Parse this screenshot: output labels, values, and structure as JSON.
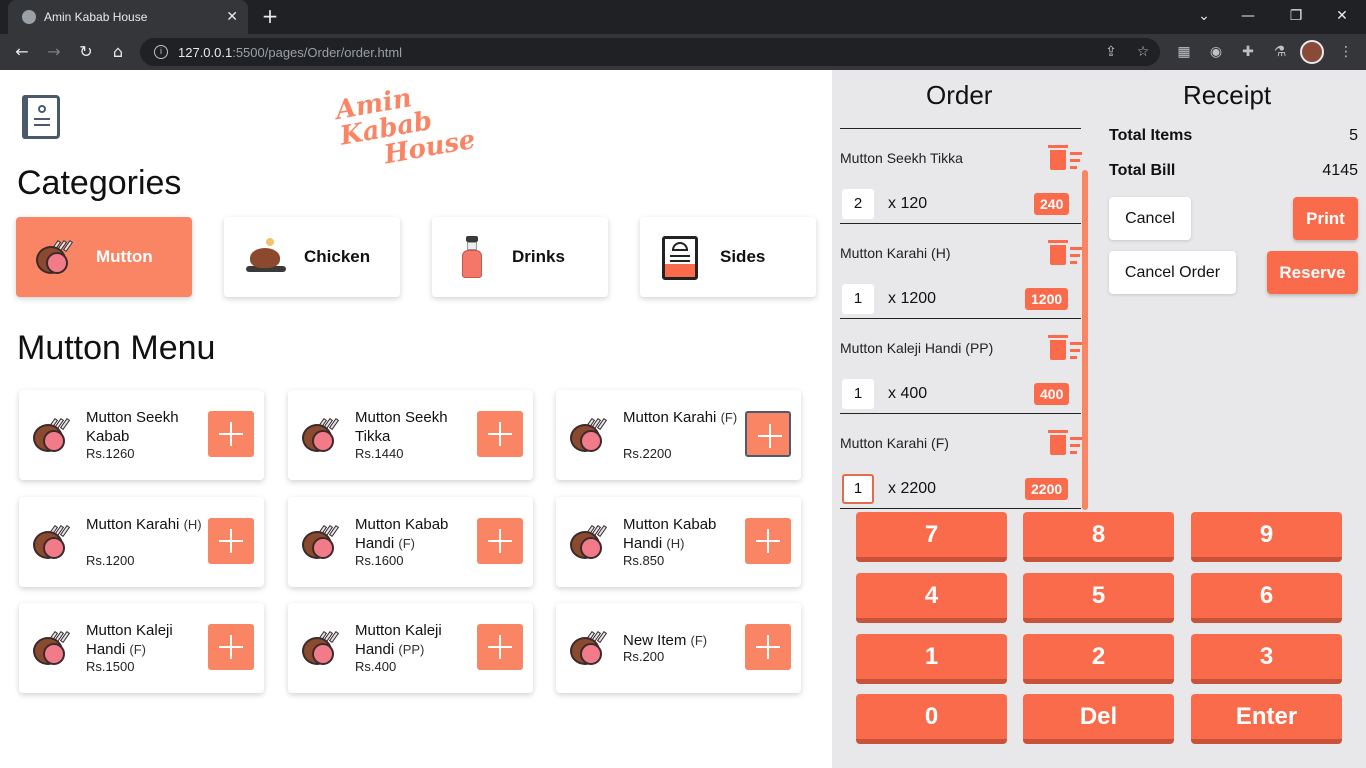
{
  "browser": {
    "tab_title": "Amin Kabab House",
    "url_host": "127.0.0.1",
    "url_path": ":5500/pages/Order/order.html"
  },
  "brand": {
    "logo_line1": "Amin Kabab",
    "logo_line2": "House",
    "accent": "#fa8564"
  },
  "categories": {
    "heading": "Categories",
    "items": [
      {
        "label": "Mutton",
        "icon": "mutton-icon",
        "active": true
      },
      {
        "label": "Chicken",
        "icon": "chicken-icon",
        "active": false
      },
      {
        "label": "Drinks",
        "icon": "drinks-icon",
        "active": false
      },
      {
        "label": "Sides",
        "icon": "sides-icon",
        "active": false
      }
    ]
  },
  "menu": {
    "heading": "Mutton Menu",
    "items": [
      {
        "name": "Mutton Seekh Kabab",
        "variant": "",
        "price": "Rs.1260"
      },
      {
        "name": "Mutton Seekh Tikka",
        "variant": "",
        "price": "Rs.1440"
      },
      {
        "name": "Mutton Karahi",
        "variant": "(F)",
        "price": "Rs.2200"
      },
      {
        "name": "Mutton Karahi",
        "variant": "(H)",
        "price": "Rs.1200"
      },
      {
        "name": "Mutton Kabab Handi",
        "variant": "(F)",
        "price": "Rs.1600"
      },
      {
        "name": "Mutton Kabab Handi",
        "variant": "(H)",
        "price": "Rs.850"
      },
      {
        "name": "Mutton Kaleji Handi",
        "variant": "(F)",
        "price": "Rs.1500"
      },
      {
        "name": "Mutton Kaleji Handi",
        "variant": "(PP)",
        "price": "Rs.400"
      },
      {
        "name": "New Item",
        "variant": "(F)",
        "price": "Rs.200"
      }
    ]
  },
  "order": {
    "title": "Order",
    "items": [
      {
        "name": "Mutton Seekh Tikka",
        "qty": "2",
        "unit_price": "x  120",
        "total": "240"
      },
      {
        "name": "Mutton Karahi (H)",
        "qty": "1",
        "unit_price": "x  1200",
        "total": "1200"
      },
      {
        "name": "Mutton Kaleji Handi (PP)",
        "qty": "1",
        "unit_price": "x  400",
        "total": "400"
      },
      {
        "name": "Mutton Karahi (F)",
        "qty": "1",
        "unit_price": "x  2200",
        "total": "2200"
      }
    ]
  },
  "receipt": {
    "title": "Receipt",
    "total_items_label": "Total Items",
    "total_items_value": "5",
    "total_bill_label": "Total Bill",
    "total_bill_value": "4145",
    "cancel_label": "Cancel",
    "print_label": "Print",
    "cancel_order_label": "Cancel Order",
    "reserve_label": "Reserve"
  },
  "keypad": {
    "keys": [
      "7",
      "8",
      "9",
      "4",
      "5",
      "6",
      "1",
      "2",
      "3",
      "0",
      "Del",
      "Enter"
    ]
  }
}
